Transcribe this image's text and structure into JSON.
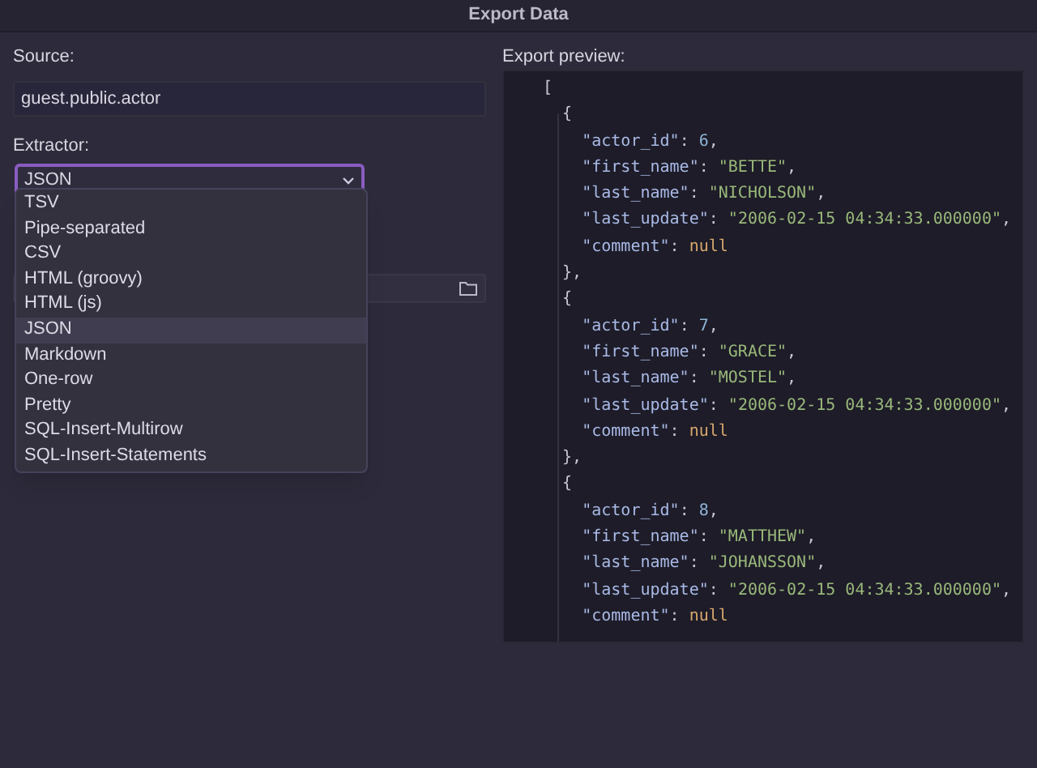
{
  "window": {
    "title": "Export Data"
  },
  "source": {
    "label": "Source:",
    "value": "guest.public.actor"
  },
  "extractor": {
    "label": "Extractor:",
    "value": "JSON",
    "expanded": true,
    "options": [
      {
        "label": "TSV",
        "selected": false
      },
      {
        "label": "Pipe-separated",
        "selected": false
      },
      {
        "label": "CSV",
        "selected": false
      },
      {
        "label": "HTML (groovy)",
        "selected": false
      },
      {
        "label": "HTML (js)",
        "selected": false
      },
      {
        "label": "JSON",
        "selected": true
      },
      {
        "label": "Markdown",
        "selected": false
      },
      {
        "label": "One-row",
        "selected": false
      },
      {
        "label": "Pretty",
        "selected": false
      },
      {
        "label": "SQL-Insert-Multirow",
        "selected": false
      },
      {
        "label": "SQL-Insert-Statements",
        "selected": false
      }
    ]
  },
  "preview": {
    "label": "Export preview:",
    "lines": [
      "[",
      "  {",
      "    \"actor_id\": 6,",
      "    \"first_name\": \"BETTE\",",
      "    \"last_name\": \"NICHOLSON\",",
      "    \"last_update\": \"2006-02-15 04:34:33.000000\",",
      "    \"comment\": null",
      "  },",
      "  {",
      "    \"actor_id\": 7,",
      "    \"first_name\": \"GRACE\",",
      "    \"last_name\": \"MOSTEL\",",
      "    \"last_update\": \"2006-02-15 04:34:33.000000\",",
      "    \"comment\": null",
      "  },",
      "  {",
      "    \"actor_id\": 8,",
      "    \"first_name\": \"MATTHEW\",",
      "    \"last_name\": \"JOHANSSON\",",
      "    \"last_update\": \"2006-02-15 04:34:33.000000\",",
      "    \"comment\": null"
    ]
  }
}
